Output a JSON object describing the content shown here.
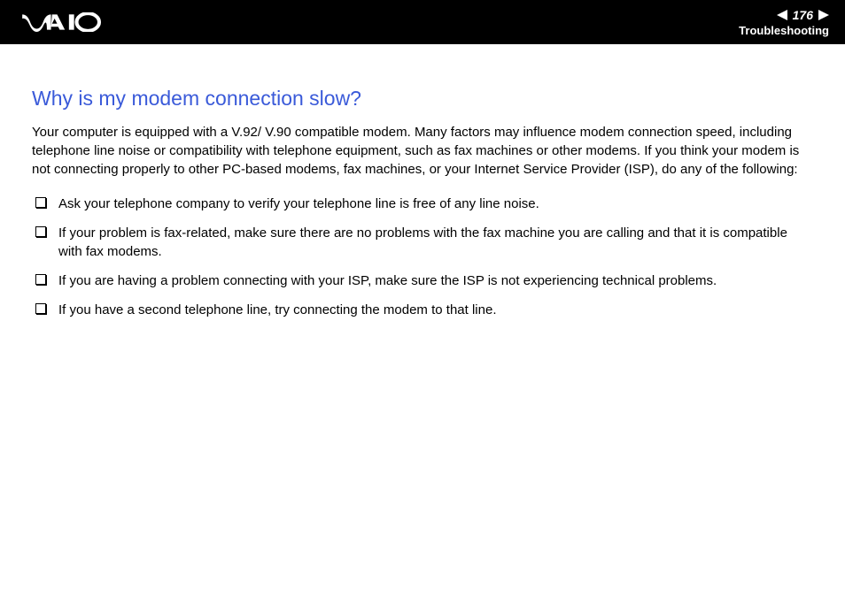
{
  "header": {
    "page_number": "176",
    "section": "Troubleshooting"
  },
  "content": {
    "title": "Why is my modem connection slow?",
    "paragraph": "Your computer is equipped with a V.92/ V.90 compatible modem. Many factors may influence modem connection speed, including telephone line noise or compatibility with telephone equipment, such as fax machines or other modems. If you think your modem is not connecting properly to other PC-based modems, fax machines, or your Internet Service Provider (ISP), do any of the following:",
    "bullets": [
      "Ask your telephone company to verify your telephone line is free of any line noise.",
      "If your problem is fax-related, make sure there are no problems with the fax machine you are calling and that it is compatible with fax modems.",
      "If you are having a problem connecting with your ISP, make sure the ISP is not experiencing technical problems.",
      "If you have a second telephone line, try connecting the modem to that line."
    ]
  }
}
